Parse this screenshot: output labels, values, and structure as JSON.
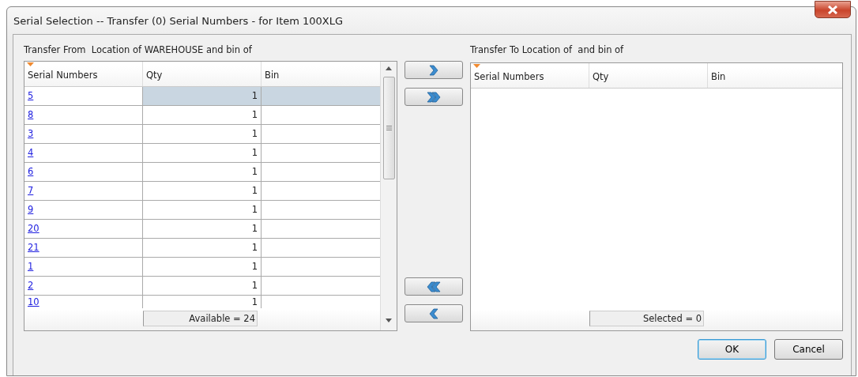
{
  "window": {
    "title": "Serial Selection -- Transfer (0) Serial Numbers - for Item 100XLG"
  },
  "from": {
    "label": "Transfer From  Location of WAREHOUSE and bin of",
    "columns": [
      "Serial Numbers",
      "Qty",
      "Bin"
    ],
    "rows": [
      {
        "serial": "5",
        "qty": "1",
        "selected": true
      },
      {
        "serial": "8",
        "qty": "1",
        "selected": false
      },
      {
        "serial": "3",
        "qty": "1",
        "selected": false
      },
      {
        "serial": "4",
        "qty": "1",
        "selected": false
      },
      {
        "serial": "6",
        "qty": "1",
        "selected": false
      },
      {
        "serial": "7",
        "qty": "1",
        "selected": false
      },
      {
        "serial": "9",
        "qty": "1",
        "selected": false
      },
      {
        "serial": "20",
        "qty": "1",
        "selected": false
      },
      {
        "serial": "21",
        "qty": "1",
        "selected": false
      },
      {
        "serial": "1",
        "qty": "1",
        "selected": false
      },
      {
        "serial": "2",
        "qty": "1",
        "selected": false
      },
      {
        "serial": "10",
        "qty": "1",
        "selected": false
      }
    ],
    "footer": "Available = 24"
  },
  "to": {
    "label": "Transfer To Location of  and bin of",
    "columns": [
      "Serial Numbers",
      "Qty",
      "Bin"
    ],
    "footer": "Selected = 0"
  },
  "transfer_buttons": [
    {
      "kind": "add-one"
    },
    {
      "kind": "add-all"
    },
    {
      "kind": "remove-all"
    },
    {
      "kind": "remove-one"
    }
  ],
  "buttons": [
    {
      "label": "OK",
      "kind": "default"
    },
    {
      "label": "Cancel",
      "kind": "normal"
    }
  ]
}
